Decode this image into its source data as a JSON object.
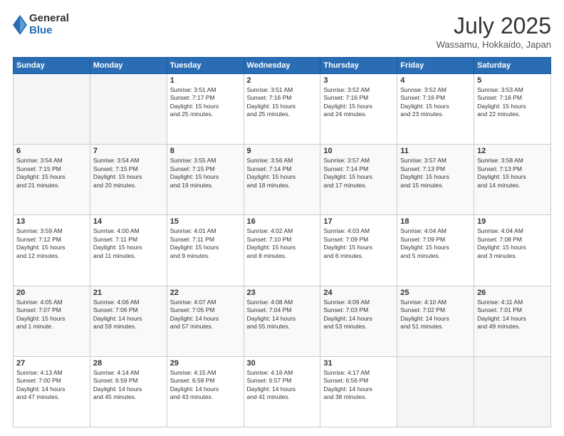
{
  "logo": {
    "general": "General",
    "blue": "Blue"
  },
  "header": {
    "month": "July 2025",
    "location": "Wassamu, Hokkaido, Japan"
  },
  "days_of_week": [
    "Sunday",
    "Monday",
    "Tuesday",
    "Wednesday",
    "Thursday",
    "Friday",
    "Saturday"
  ],
  "weeks": [
    [
      {
        "day": "",
        "info": ""
      },
      {
        "day": "",
        "info": ""
      },
      {
        "day": "1",
        "info": "Sunrise: 3:51 AM\nSunset: 7:17 PM\nDaylight: 15 hours\nand 25 minutes."
      },
      {
        "day": "2",
        "info": "Sunrise: 3:51 AM\nSunset: 7:16 PM\nDaylight: 15 hours\nand 25 minutes."
      },
      {
        "day": "3",
        "info": "Sunrise: 3:52 AM\nSunset: 7:16 PM\nDaylight: 15 hours\nand 24 minutes."
      },
      {
        "day": "4",
        "info": "Sunrise: 3:52 AM\nSunset: 7:16 PM\nDaylight: 15 hours\nand 23 minutes."
      },
      {
        "day": "5",
        "info": "Sunrise: 3:53 AM\nSunset: 7:16 PM\nDaylight: 15 hours\nand 22 minutes."
      }
    ],
    [
      {
        "day": "6",
        "info": "Sunrise: 3:54 AM\nSunset: 7:15 PM\nDaylight: 15 hours\nand 21 minutes."
      },
      {
        "day": "7",
        "info": "Sunrise: 3:54 AM\nSunset: 7:15 PM\nDaylight: 15 hours\nand 20 minutes."
      },
      {
        "day": "8",
        "info": "Sunrise: 3:55 AM\nSunset: 7:15 PM\nDaylight: 15 hours\nand 19 minutes."
      },
      {
        "day": "9",
        "info": "Sunrise: 3:56 AM\nSunset: 7:14 PM\nDaylight: 15 hours\nand 18 minutes."
      },
      {
        "day": "10",
        "info": "Sunrise: 3:57 AM\nSunset: 7:14 PM\nDaylight: 15 hours\nand 17 minutes."
      },
      {
        "day": "11",
        "info": "Sunrise: 3:57 AM\nSunset: 7:13 PM\nDaylight: 15 hours\nand 15 minutes."
      },
      {
        "day": "12",
        "info": "Sunrise: 3:58 AM\nSunset: 7:13 PM\nDaylight: 15 hours\nand 14 minutes."
      }
    ],
    [
      {
        "day": "13",
        "info": "Sunrise: 3:59 AM\nSunset: 7:12 PM\nDaylight: 15 hours\nand 12 minutes."
      },
      {
        "day": "14",
        "info": "Sunrise: 4:00 AM\nSunset: 7:11 PM\nDaylight: 15 hours\nand 11 minutes."
      },
      {
        "day": "15",
        "info": "Sunrise: 4:01 AM\nSunset: 7:11 PM\nDaylight: 15 hours\nand 9 minutes."
      },
      {
        "day": "16",
        "info": "Sunrise: 4:02 AM\nSunset: 7:10 PM\nDaylight: 15 hours\nand 8 minutes."
      },
      {
        "day": "17",
        "info": "Sunrise: 4:03 AM\nSunset: 7:09 PM\nDaylight: 15 hours\nand 6 minutes."
      },
      {
        "day": "18",
        "info": "Sunrise: 4:04 AM\nSunset: 7:09 PM\nDaylight: 15 hours\nand 5 minutes."
      },
      {
        "day": "19",
        "info": "Sunrise: 4:04 AM\nSunset: 7:08 PM\nDaylight: 15 hours\nand 3 minutes."
      }
    ],
    [
      {
        "day": "20",
        "info": "Sunrise: 4:05 AM\nSunset: 7:07 PM\nDaylight: 15 hours\nand 1 minute."
      },
      {
        "day": "21",
        "info": "Sunrise: 4:06 AM\nSunset: 7:06 PM\nDaylight: 14 hours\nand 59 minutes."
      },
      {
        "day": "22",
        "info": "Sunrise: 4:07 AM\nSunset: 7:05 PM\nDaylight: 14 hours\nand 57 minutes."
      },
      {
        "day": "23",
        "info": "Sunrise: 4:08 AM\nSunset: 7:04 PM\nDaylight: 14 hours\nand 55 minutes."
      },
      {
        "day": "24",
        "info": "Sunrise: 4:09 AM\nSunset: 7:03 PM\nDaylight: 14 hours\nand 53 minutes."
      },
      {
        "day": "25",
        "info": "Sunrise: 4:10 AM\nSunset: 7:02 PM\nDaylight: 14 hours\nand 51 minutes."
      },
      {
        "day": "26",
        "info": "Sunrise: 4:11 AM\nSunset: 7:01 PM\nDaylight: 14 hours\nand 49 minutes."
      }
    ],
    [
      {
        "day": "27",
        "info": "Sunrise: 4:13 AM\nSunset: 7:00 PM\nDaylight: 14 hours\nand 47 minutes."
      },
      {
        "day": "28",
        "info": "Sunrise: 4:14 AM\nSunset: 6:59 PM\nDaylight: 14 hours\nand 45 minutes."
      },
      {
        "day": "29",
        "info": "Sunrise: 4:15 AM\nSunset: 6:58 PM\nDaylight: 14 hours\nand 43 minutes."
      },
      {
        "day": "30",
        "info": "Sunrise: 4:16 AM\nSunset: 6:57 PM\nDaylight: 14 hours\nand 41 minutes."
      },
      {
        "day": "31",
        "info": "Sunrise: 4:17 AM\nSunset: 6:56 PM\nDaylight: 14 hours\nand 38 minutes."
      },
      {
        "day": "",
        "info": ""
      },
      {
        "day": "",
        "info": ""
      }
    ]
  ]
}
